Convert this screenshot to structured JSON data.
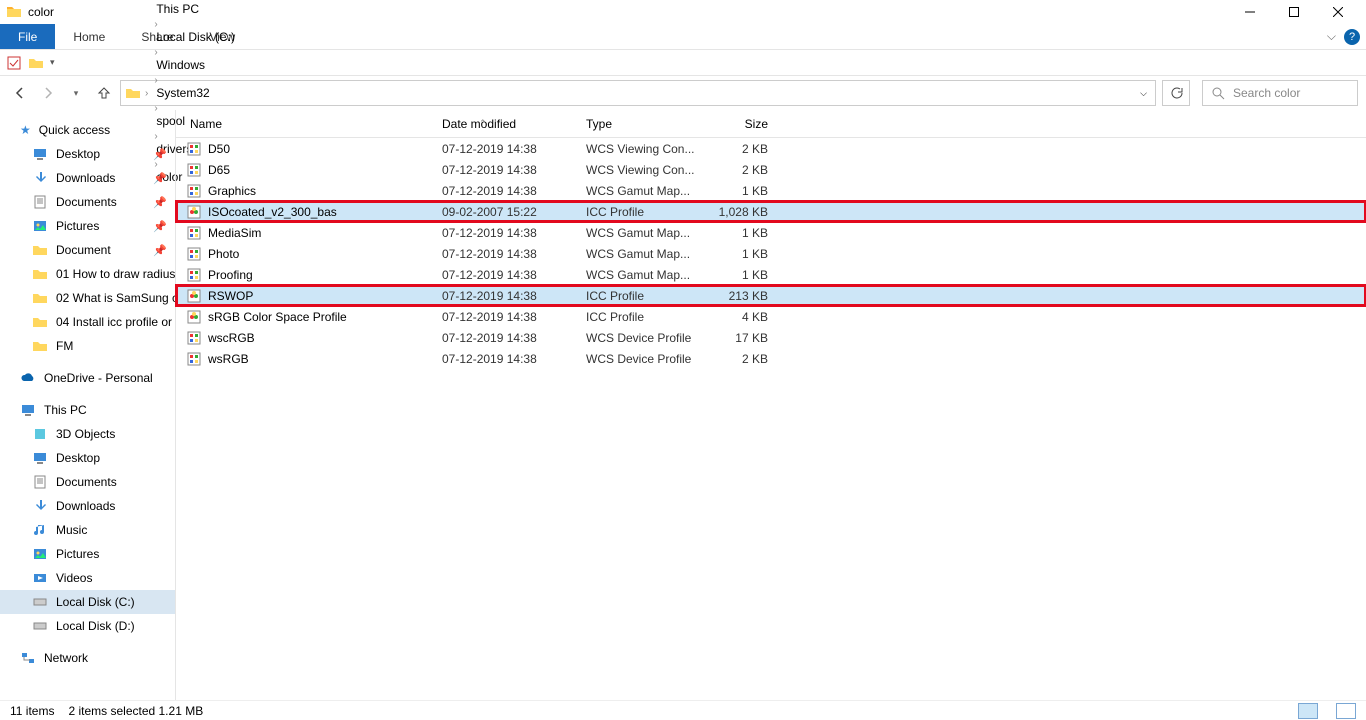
{
  "window": {
    "title": "color"
  },
  "menu": {
    "file": "File",
    "home": "Home",
    "share": "Share",
    "view": "View"
  },
  "breadcrumb": [
    "This PC",
    "Local Disk (C:)",
    "Windows",
    "System32",
    "spool",
    "drivers",
    "color"
  ],
  "search": {
    "placeholder": "Search color"
  },
  "columns": {
    "name": "Name",
    "date": "Date modified",
    "type": "Type",
    "size": "Size"
  },
  "sidebar": {
    "quick": "Quick access",
    "quick_items": [
      {
        "label": "Desktop",
        "pin": true
      },
      {
        "label": "Downloads",
        "pin": true
      },
      {
        "label": "Documents",
        "pin": true
      },
      {
        "label": "Pictures",
        "pin": true
      },
      {
        "label": "Document",
        "pin": true
      },
      {
        "label": "01 How to draw radius"
      },
      {
        "label": "02 What is SamSung c"
      },
      {
        "label": "04 Install icc profile or"
      },
      {
        "label": "FM"
      }
    ],
    "onedrive": "OneDrive - Personal",
    "thispc": "This PC",
    "pc_items": [
      "3D Objects",
      "Desktop",
      "Documents",
      "Downloads",
      "Music",
      "Pictures",
      "Videos",
      "Local Disk (C:)",
      "Local Disk (D:)"
    ],
    "network": "Network"
  },
  "files": [
    {
      "name": "D50",
      "date": "07-12-2019 14:38",
      "type": "WCS Viewing Con...",
      "size": "2 KB",
      "icon": "wcs"
    },
    {
      "name": "D65",
      "date": "07-12-2019 14:38",
      "type": "WCS Viewing Con...",
      "size": "2 KB",
      "icon": "wcs"
    },
    {
      "name": "Graphics",
      "date": "07-12-2019 14:38",
      "type": "WCS Gamut Map...",
      "size": "1 KB",
      "icon": "wcs"
    },
    {
      "name": "ISOcoated_v2_300_bas",
      "date": "09-02-2007 15:22",
      "type": "ICC Profile",
      "size": "1,028 KB",
      "icon": "icc",
      "selected": true,
      "highlight": true
    },
    {
      "name": "MediaSim",
      "date": "07-12-2019 14:38",
      "type": "WCS Gamut Map...",
      "size": "1 KB",
      "icon": "wcs"
    },
    {
      "name": "Photo",
      "date": "07-12-2019 14:38",
      "type": "WCS Gamut Map...",
      "size": "1 KB",
      "icon": "wcs"
    },
    {
      "name": "Proofing",
      "date": "07-12-2019 14:38",
      "type": "WCS Gamut Map...",
      "size": "1 KB",
      "icon": "wcs"
    },
    {
      "name": "RSWOP",
      "date": "07-12-2019 14:38",
      "type": "ICC Profile",
      "size": "213 KB",
      "icon": "icc",
      "selected": true,
      "highlight": true
    },
    {
      "name": "sRGB Color Space Profile",
      "date": "07-12-2019 14:38",
      "type": "ICC Profile",
      "size": "4 KB",
      "icon": "icc"
    },
    {
      "name": "wscRGB",
      "date": "07-12-2019 14:38",
      "type": "WCS Device Profile",
      "size": "17 KB",
      "icon": "wcs"
    },
    {
      "name": "wsRGB",
      "date": "07-12-2019 14:38",
      "type": "WCS Device Profile",
      "size": "2 KB",
      "icon": "wcs"
    }
  ],
  "status": {
    "count": "11 items",
    "selected": "2 items selected  1.21 MB"
  }
}
